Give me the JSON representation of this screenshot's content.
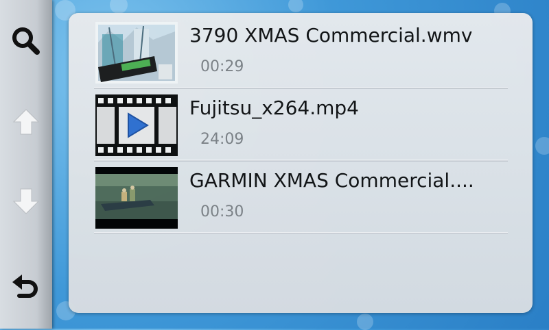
{
  "toolbar": {
    "search_icon": "search-icon",
    "up_icon": "arrow-up-icon",
    "down_icon": "arrow-down-icon",
    "back_icon": "back-icon"
  },
  "videos": [
    {
      "title": "3790 XMAS Commercial.wmv",
      "duration": "00:29",
      "thumbnail": "xmas-commercial-thumbnail"
    },
    {
      "title": "Fujitsu_x264.mp4",
      "duration": "24:09",
      "thumbnail": "generic-video-filmstrip-icon"
    },
    {
      "title": "GARMIN XMAS Commercial....",
      "duration": "00:30",
      "thumbnail": "boat-scene-thumbnail"
    }
  ],
  "colors": {
    "background": "#3f98d8",
    "panel": "#e2e6ea",
    "title_text": "#111111",
    "duration_text": "#7d8185",
    "play_icon": "#2f6fd0"
  }
}
